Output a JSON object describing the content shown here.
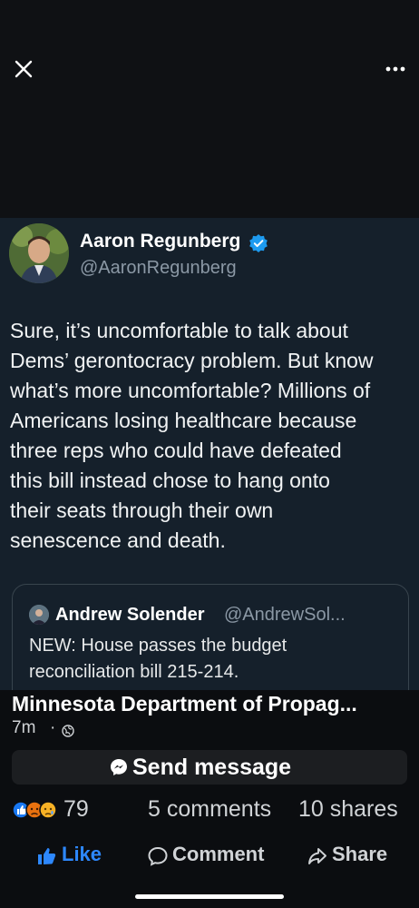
{
  "window": {
    "close_icon": "close-icon",
    "more_icon": "more-horizontal-icon"
  },
  "tweet": {
    "author_name": "Aaron Regunberg",
    "author_handle": "@AaronRegunberg",
    "verified_color": "#1d9bf0",
    "text": "Sure, it’s uncomfortable to talk about\nDems’ gerontocracy problem. But know\nwhat’s more uncomfortable? Millions of\nAmericans losing healthcare because\nthree reps who could have defeated\nthis bill instead chose to hang onto\ntheir seats through their own\nsenescence and death.",
    "quote": {
      "author_name": "Andrew Solender",
      "author_handle": "@AndrewSol...",
      "text": "NEW: House passes the budget\nreconciliation bill 215-214."
    }
  },
  "post": {
    "page_name": "Minnesota Department of Propag...",
    "time": "7m",
    "separator": "·",
    "audience_icon": "globe-icon",
    "send_message_label": "Send message",
    "reaction_count": "79",
    "comments": "5 comments",
    "shares": "10 shares",
    "actions": {
      "like": "Like",
      "comment": "Comment",
      "share": "Share"
    }
  },
  "colors": {
    "accent": "#2d88ff",
    "background": "#0b0d10",
    "card": "#15202b"
  }
}
